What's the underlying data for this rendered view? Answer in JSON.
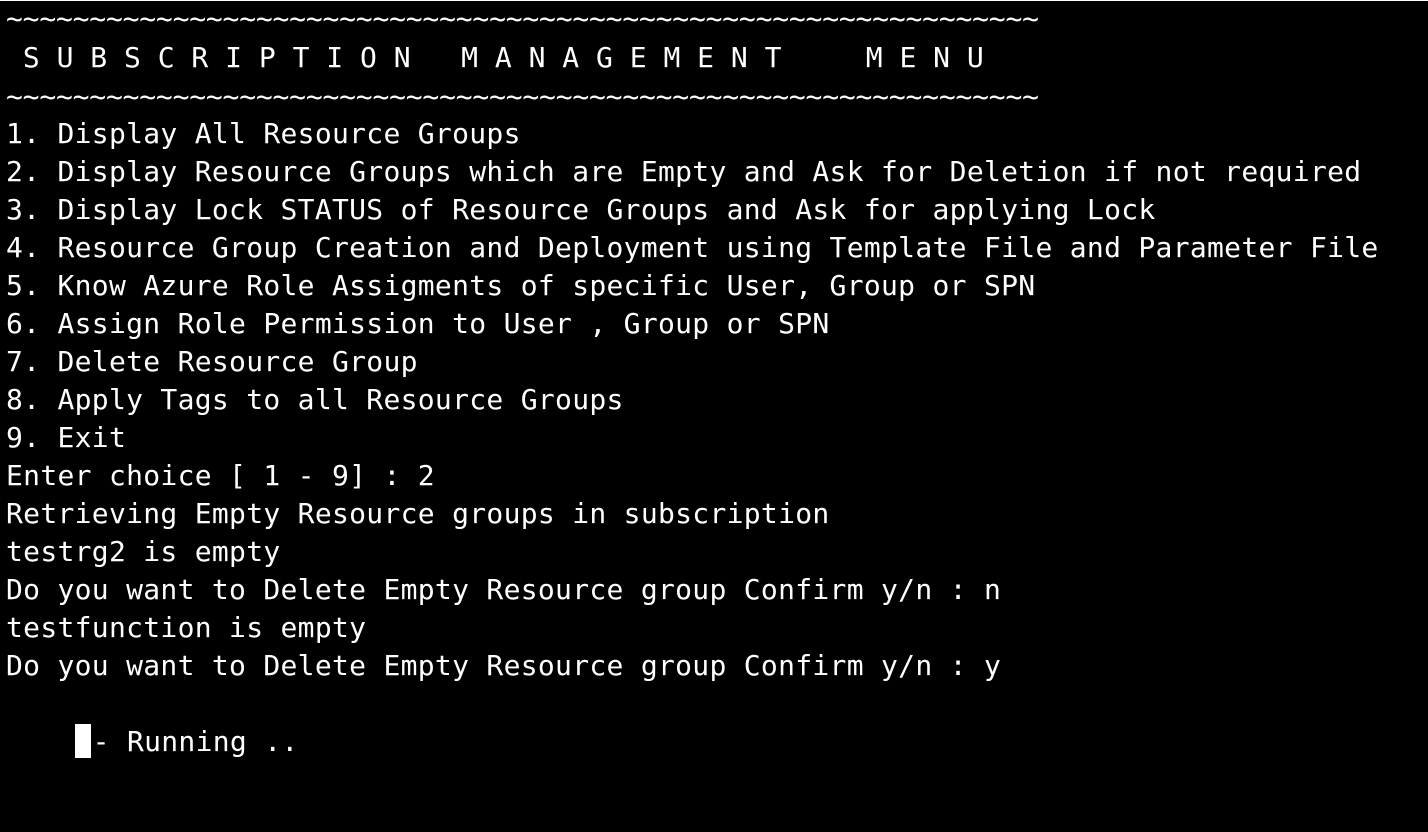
{
  "header": {
    "rule_top": "~~~~~~~~~~~~~~~~~~~~~~~~~~~~~~~~~~~~~~~~~~~~~~~~~~~~~~~~~~~~~~",
    "title": " S U B S C R I P T I O N   M A N A G E M E N T     M E N U",
    "rule_bottom": "~~~~~~~~~~~~~~~~~~~~~~~~~~~~~~~~~~~~~~~~~~~~~~~~~~~~~~~~~~~~~~"
  },
  "menu": {
    "items": [
      "1. Display All Resource Groups",
      "2. Display Resource Groups which are Empty and Ask for Deletion if not required",
      "3. Display Lock STATUS of Resource Groups and Ask for applying Lock",
      "4. Resource Group Creation and Deployment using Template File and Parameter File",
      "5. Know Azure Role Assigments of specific User, Group or SPN",
      "6. Assign Role Permission to User , Group or SPN",
      "7. Delete Resource Group",
      "8. Apply Tags to all Resource Groups",
      "9. Exit"
    ]
  },
  "output": {
    "lines": [
      "Enter choice [ 1 - 9] : 2",
      "Retrieving Empty Resource groups in subscription",
      "testrg2 is empty",
      "Do you want to Delete Empty Resource group Confirm y/n : n",
      "testfunction is empty",
      "Do you want to Delete Empty Resource group Confirm y/n : y"
    ],
    "status": "- Running .."
  },
  "colors": {
    "background": "#000000",
    "foreground": "#ffffff"
  }
}
